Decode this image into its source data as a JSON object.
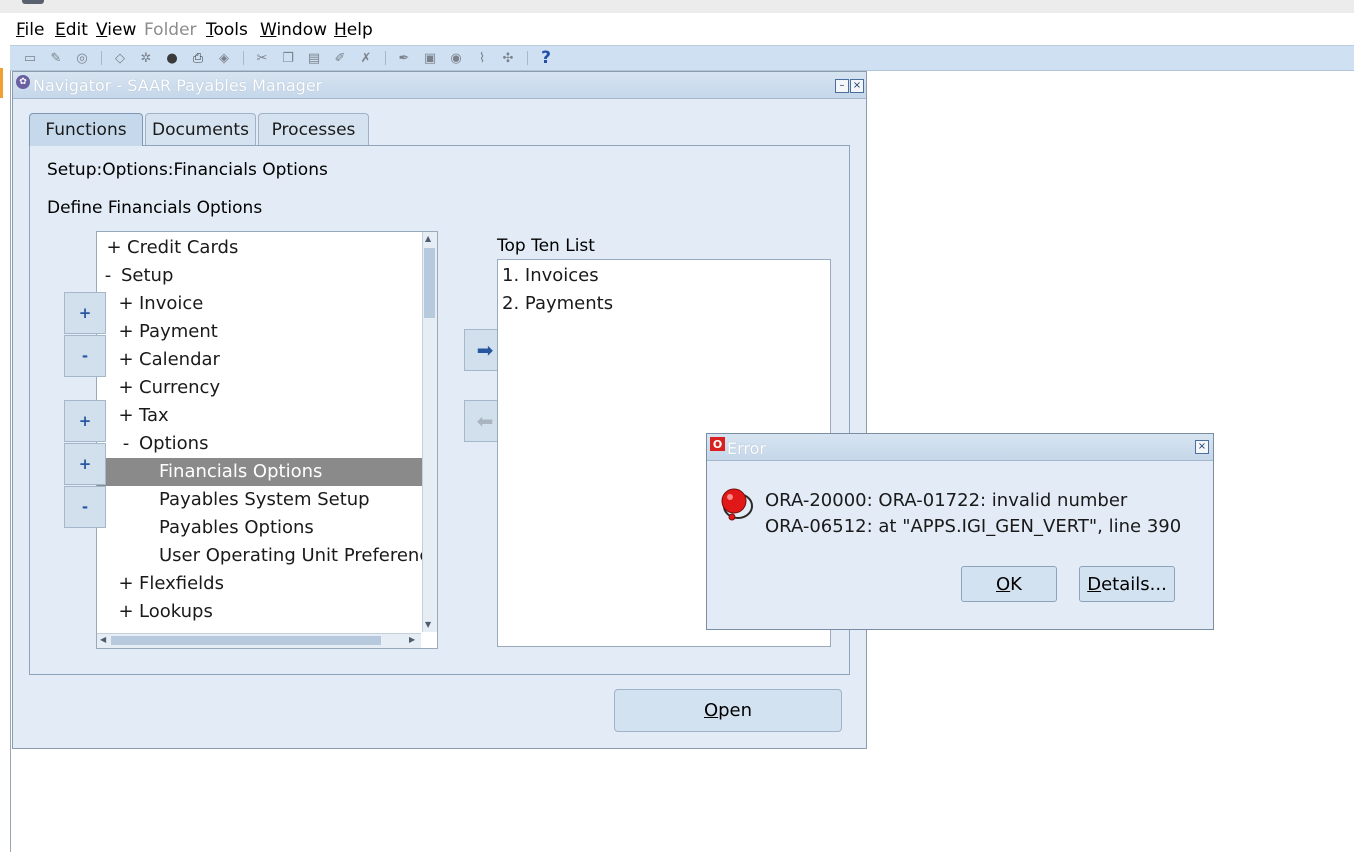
{
  "menubar": {
    "file": {
      "u": "F",
      "rest": "ile"
    },
    "edit": {
      "u": "E",
      "rest": "dit"
    },
    "view": {
      "u": "V",
      "rest": "iew"
    },
    "folder": "Folder",
    "tools": {
      "u": "T",
      "rest": "ools"
    },
    "window": {
      "u": "W",
      "rest": "indow"
    },
    "help": {
      "u": "H",
      "rest": "elp"
    }
  },
  "toolbar": {
    "help_glyph": "?"
  },
  "navigator": {
    "title": "Navigator - SAAR Payables Manager",
    "minimize": "–",
    "close": "×",
    "tabs": [
      "Functions",
      "Documents",
      "Processes"
    ],
    "path": "Setup:Options:Financials Options",
    "description": "Define Financials Options",
    "tree": [
      {
        "pm": "+",
        "label": "Credit Cards"
      },
      {
        "pm": "-",
        "label": "Setup"
      },
      {
        "pm": "+",
        "label": "Invoice"
      },
      {
        "pm": "+",
        "label": "Payment"
      },
      {
        "pm": "+",
        "label": "Calendar"
      },
      {
        "pm": "+",
        "label": "Currency"
      },
      {
        "pm": "+",
        "label": "Tax"
      },
      {
        "pm": "-",
        "label": "Options"
      },
      {
        "pm": "",
        "label": "Financials Options"
      },
      {
        "pm": "",
        "label": "Payables System Setup"
      },
      {
        "pm": "",
        "label": "Payables Options"
      },
      {
        "pm": "",
        "label": "User Operating Unit Preferences"
      },
      {
        "pm": "+",
        "label": "Flexfields"
      },
      {
        "pm": "+",
        "label": "Lookups"
      }
    ],
    "side_buttons": {
      "expand": "+",
      "collapse": "-",
      "expand_branch": "+",
      "expand_all": "+",
      "collapse_all": "-"
    },
    "move_right": "➡",
    "move_left": "⬅",
    "top_ten_label": "Top Ten List",
    "top_ten": [
      "1. Invoices",
      "2. Payments"
    ],
    "open_button": {
      "u": "O",
      "rest": "pen"
    }
  },
  "error_dialog": {
    "title": "Error",
    "close": "×",
    "icon_letter": "O",
    "line1": "ORA-20000: ORA-01722: invalid number",
    "line2": "ORA-06512: at \"APPS.IGI_GEN_VERT\", line 390",
    "ok": {
      "u": "O",
      "rest": "K"
    },
    "details": {
      "u": "D",
      "rest": "etails..."
    }
  },
  "colors": {
    "title_bar": "#c5d7ea",
    "window_bg": "#e3ecf6",
    "toolbar_bg": "#cfe0f2",
    "selection": "#8a8a8a",
    "accent_blue": "#2856a0",
    "error_red": "#d82020"
  }
}
